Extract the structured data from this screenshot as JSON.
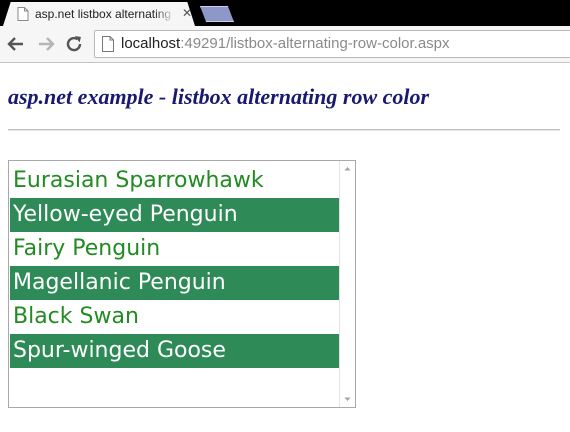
{
  "browser": {
    "tab_title": "asp.net listbox alternating",
    "tab_close": "✕",
    "url_host": "localhost",
    "url_rest": ":49291/listbox-alternating-row-color.aspx"
  },
  "page": {
    "title": "asp.net example - listbox alternating row color"
  },
  "listbox": {
    "items": [
      "Eurasian Sparrowhawk",
      "Yellow-eyed Penguin",
      "Fairy Penguin",
      "Magellanic Penguin",
      "Black Swan",
      "Spur-winged Goose"
    ],
    "odd_row_color": "#228b22",
    "even_row_background": "#2e8b57",
    "even_row_text_color": "#ffffff"
  },
  "icons": {
    "tab_favicon": "page-icon",
    "back": "arrow-left-icon",
    "forward": "arrow-right-icon",
    "reload": "reload-icon",
    "omnibox_page": "page-icon",
    "scroll_up": "triangle-up-icon",
    "scroll_down": "triangle-down-icon"
  }
}
